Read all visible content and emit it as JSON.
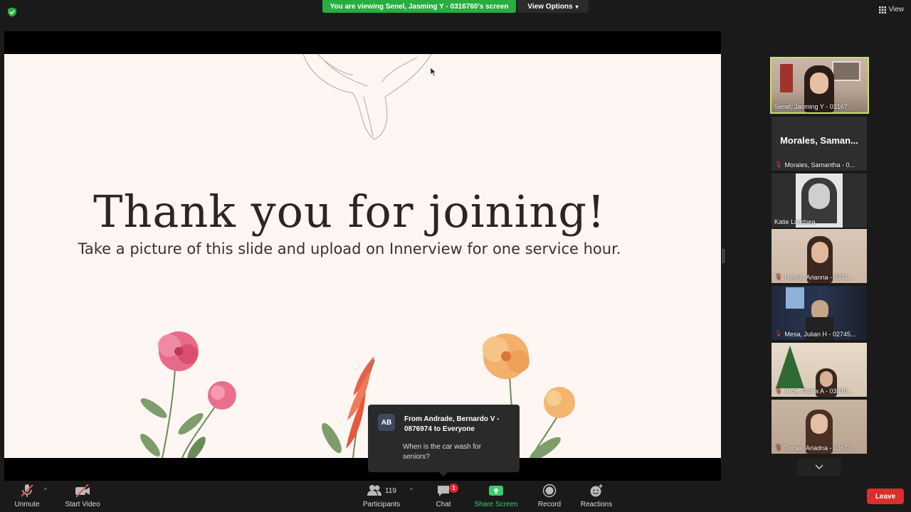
{
  "header": {
    "viewing_banner": "You are viewing Senel, Jasming Y - 0316760's screen",
    "view_options": "View Options",
    "view_label": "View"
  },
  "slide": {
    "title": "Thank you for joining!",
    "subtitle": "Take a picture of this slide and upload on Innerview for one service hour."
  },
  "chat_popup": {
    "avatar_initials": "AB",
    "from": "From Andrade, Bernardo V - 0876974 to Everyone",
    "message": "When is the car wash for seniors?"
  },
  "gallery": {
    "tiles": [
      {
        "label": "Senel, Jasming Y - 03167...",
        "muted": false,
        "active": true
      },
      {
        "big_name": "Morales,  Saman...",
        "label": "Morales, Samantha - 0...",
        "muted": true
      },
      {
        "label": "Katie Landsea",
        "muted": false
      },
      {
        "label": "Hoyos, Arianna - 0371...",
        "muted": true
      },
      {
        "label": "Mesa, Julian H - 02745...",
        "muted": true
      },
      {
        "label": "Arce, Gloria A - 03870...",
        "muted": true
      },
      {
        "label": "Torras, Ariadna - 0367...",
        "muted": true
      }
    ]
  },
  "toolbar": {
    "unmute": "Unmute",
    "start_video": "Start Video",
    "participants": "Participants",
    "participants_count": "119",
    "chat": "Chat",
    "chat_badge": "1",
    "share_screen": "Share Screen",
    "record": "Record",
    "reactions": "Reactions",
    "leave": "Leave"
  },
  "colors": {
    "banner_green": "#27ae3f",
    "active_tile_border": "#cde54a",
    "leave_red": "#d9302c",
    "share_green": "#33d06b"
  }
}
